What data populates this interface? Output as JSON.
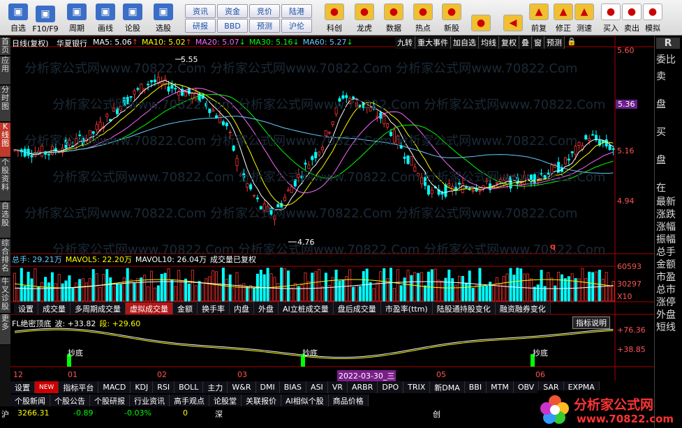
{
  "toolbar": {
    "items": [
      {
        "label": "自选",
        "icon": "star-icon"
      },
      {
        "label": "F10/F9",
        "icon": "f10-icon"
      },
      {
        "label": "周期",
        "icon": "clock-icon"
      },
      {
        "label": "画线",
        "icon": "pencil-icon"
      },
      {
        "label": "论股",
        "icon": "discuss-icon"
      },
      {
        "label": "选股",
        "icon": "select-stock-icon"
      }
    ],
    "mini": [
      [
        "资讯",
        "资金",
        "竞价",
        "陆港"
      ],
      [
        "研报",
        "BBD",
        "预测",
        "沪伦"
      ]
    ],
    "right": [
      {
        "label": "科创",
        "icon": "star-market-icon"
      },
      {
        "label": "龙虎",
        "icon": "dragon-icon"
      },
      {
        "label": "数据",
        "icon": "pe-icon"
      },
      {
        "label": "热点",
        "icon": "hot-icon"
      },
      {
        "label": "新股",
        "icon": "new-stock-icon"
      },
      {
        "label": "",
        "icon": "grid-icon"
      },
      {
        "label": "",
        "icon": "back-arrow-icon"
      },
      {
        "label": "前复",
        "icon": "up-icon"
      },
      {
        "label": "修正",
        "icon": "adjust-icon"
      },
      {
        "label": "测速",
        "icon": "speed-icon"
      },
      {
        "label": "买入",
        "icon": "buy-icon"
      },
      {
        "label": "卖出",
        "icon": "sell-icon"
      },
      {
        "label": "模拟",
        "icon": "hammer-icon"
      }
    ]
  },
  "left_tabs": [
    "首页",
    "应用",
    "分时图",
    "K线图",
    "个股资料",
    "自选股",
    "综合排名",
    "牛叉诊股",
    "更多"
  ],
  "right_panel": [
    "R",
    "委比",
    "卖",
    "盘",
    "买",
    "盘",
    "在",
    "最新",
    "涨跌",
    "涨幅",
    "振幅",
    "总手",
    "金额",
    "市盈",
    "总市",
    "涨停",
    "外盘",
    "短线"
  ],
  "header": {
    "title": "日线(复权)",
    "stock": "华夏银行",
    "ma": [
      {
        "label": "MA5: 5.06",
        "color": "#ffffff",
        "arrow": "↑"
      },
      {
        "label": "MA10: 5.02",
        "color": "#ffff00",
        "arrow": "↑"
      },
      {
        "label": "MA20: 5.07",
        "color": "#ff66ff",
        "arrow": "↓"
      },
      {
        "label": "MA30: 5.16",
        "color": "#00ff00",
        "arrow": "↓"
      },
      {
        "label": "MA60: 5.27",
        "color": "#66ccff",
        "arrow": "↓"
      }
    ],
    "buttons": [
      "九转",
      "重大事件",
      "加自选",
      "均线",
      "复权",
      "叠",
      "窗",
      "预测"
    ]
  },
  "price_axis": [
    "5.60",
    "5.36",
    "5.16",
    "4.94"
  ],
  "annotations": {
    "high": "5.55",
    "low": "4.76"
  },
  "vol": {
    "total": "总手: 29.21万",
    "mavol5": "MAVOL5: 22.20万",
    "mavol10": "MAVOL10: 26.04万",
    "note": "成交量已复权",
    "axis": [
      "60593",
      "30297",
      "X10"
    ]
  },
  "vol_tabs": [
    "设置",
    "成交量",
    "多周期成交量",
    "虚拟成交量",
    "金额",
    "换手率",
    "内盘",
    "外盘",
    "AI立桩成交量",
    "盘后成交量",
    "市盈率(ttm)",
    "陆股通持股变化",
    "融资融券变化"
  ],
  "ind": {
    "name": "FL绝密顶底",
    "wave": "波: +33.82",
    "seg": "段: +29.60",
    "help": "指标说明",
    "axis": [
      "+76.36",
      "+38.85"
    ],
    "labels": [
      "抄底",
      "抄底",
      "抄底"
    ]
  },
  "dates": [
    "12",
    "01",
    "02",
    "03",
    "04",
    "05",
    "06"
  ],
  "cursor_date": "2022-03-30_三",
  "ind_tabs": [
    "设置",
    "NEW",
    "指标平台",
    "MACD",
    "KDJ",
    "RSI",
    "BOLL",
    "主力",
    "W&R",
    "DMI",
    "BIAS",
    "ASI",
    "VR",
    "ARBR",
    "DPO",
    "TRIX",
    "新DMA",
    "BBI",
    "MTM",
    "OBV",
    "SAR",
    "EXPMA"
  ],
  "news_tabs": [
    "个股新闻",
    "个股公告",
    "个股研报",
    "行业资讯",
    "高手观点",
    "论股堂",
    "关联报价",
    "AI相似个股",
    "商品价格"
  ],
  "status": {
    "market": "沪",
    "index": "3266.31",
    "chg": "-0.89",
    "pct": "-0.03%",
    "vol": "0",
    "m2": "深",
    "m3": "创"
  },
  "watermark": "分析家公式网www.70822.Com",
  "logo": {
    "name": "分析家公式网",
    "url": "www.70822.com"
  },
  "colors": {
    "up": "#ff3333",
    "down": "#00ffff",
    "bg": "#000000"
  },
  "chart_data": {
    "type": "candlestick",
    "ylim": [
      4.7,
      5.62
    ],
    "annotations": [
      {
        "label": "5.55"
      },
      {
        "label": "4.76"
      }
    ]
  }
}
